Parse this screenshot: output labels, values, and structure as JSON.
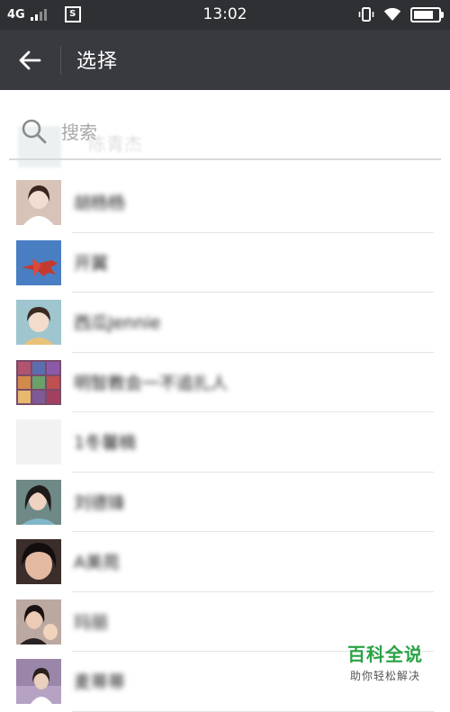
{
  "status_bar": {
    "network": "4G",
    "time": "13:02",
    "battery_level": 0.95
  },
  "header": {
    "title": "选择"
  },
  "search": {
    "placeholder": "搜索"
  },
  "ghost_row": {
    "name": "陈青杰"
  },
  "contacts": [
    {
      "name": "胡杨杨",
      "avatar_color": "#d8c3b8"
    },
    {
      "name": "开翼",
      "avatar_color": "#4a7ec2"
    },
    {
      "name": "西瓜Jennie",
      "avatar_color": "#9fc5cf"
    },
    {
      "name": "明智教会一不追扎人",
      "avatar_color": "#7a4b6b"
    },
    {
      "name": "1冬馨楠",
      "avatar_color": "#f2f2f2"
    },
    {
      "name": "刘德锋",
      "avatar_color": "#6f8a86"
    },
    {
      "name": "A美苑",
      "avatar_color": "#3b2d2a"
    },
    {
      "name": "玛丽",
      "avatar_color": "#8a6f66"
    },
    {
      "name": "麦蒂蒂",
      "avatar_color": "#9a86a8"
    }
  ],
  "watermark": {
    "title": "百科全说",
    "subtitle": "助你轻松解决"
  }
}
